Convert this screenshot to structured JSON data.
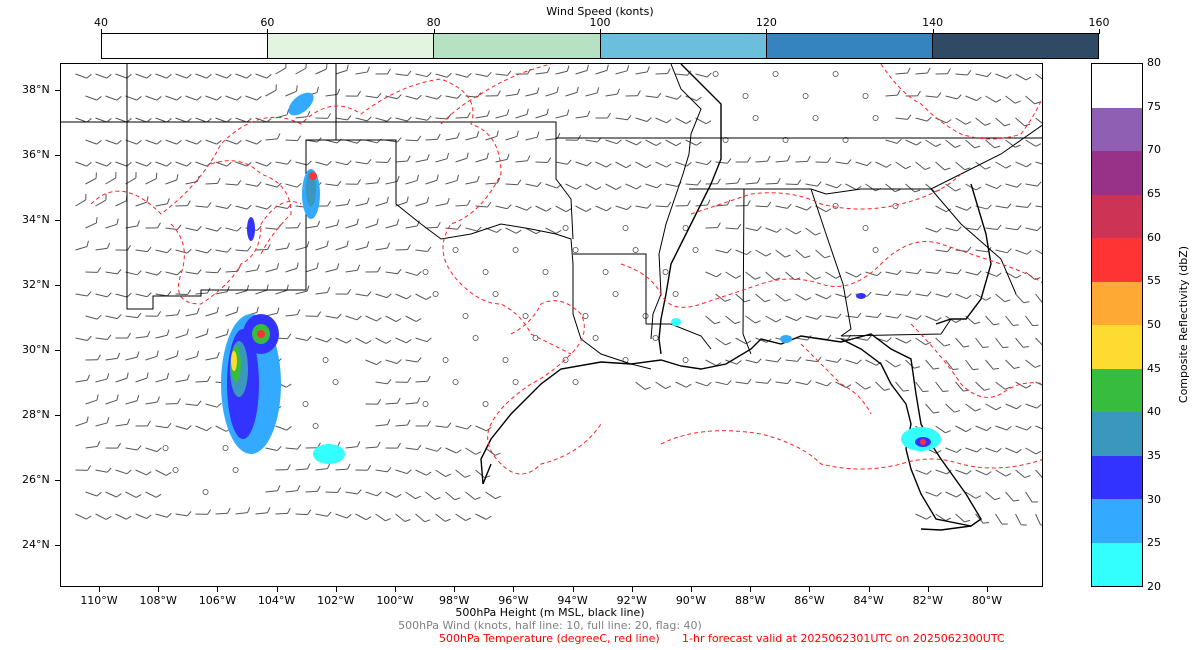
{
  "wind_colorbar": {
    "title": "Wind Speed (konts)",
    "ticks": [
      "40",
      "60",
      "80",
      "100",
      "120",
      "140",
      "160"
    ],
    "colors": [
      "#ffffff",
      "#e3f4e1",
      "#b6e2c3",
      "#6bbedc",
      "#3584c0",
      "#2e4a64"
    ]
  },
  "refl_colorbar": {
    "label": "Composite Reflectivity (dbZ)",
    "ticks": [
      "20",
      "25",
      "30",
      "35",
      "40",
      "45",
      "50",
      "55",
      "60",
      "65",
      "70",
      "75",
      "80"
    ],
    "colors": [
      "#33ffff",
      "#33aaff",
      "#3333ff",
      "#3a98bf",
      "#38bc3e",
      "#fddb31",
      "#fda933",
      "#fe3333",
      "#cc3355",
      "#983289",
      "#8e5fb3",
      "#ffffff"
    ]
  },
  "map": {
    "lat_labels": [
      "24°N",
      "26°N",
      "28°N",
      "30°N",
      "32°N",
      "34°N",
      "36°N",
      "38°N"
    ],
    "lon_labels": [
      "110°W",
      "108°W",
      "106°W",
      "104°W",
      "102°W",
      "100°W",
      "98°W",
      "96°W",
      "94°W",
      "92°W",
      "90°W",
      "88°W",
      "86°W",
      "84°W",
      "82°W",
      "80°W"
    ]
  },
  "footer": {
    "line1": "500hPa Height (m MSL, black line)",
    "line2": "500hPa Wind (knots, half line: 10, full line: 20, flag: 40)",
    "line3_left": "500hPa Temperature (degreeC, red line)",
    "line3_right": "1-hr forecast valid at 2025062301UTC on 2025062300UTC",
    "line1_color": "#000000",
    "line2_color": "#808080",
    "line3_color": "#ff0000"
  }
}
